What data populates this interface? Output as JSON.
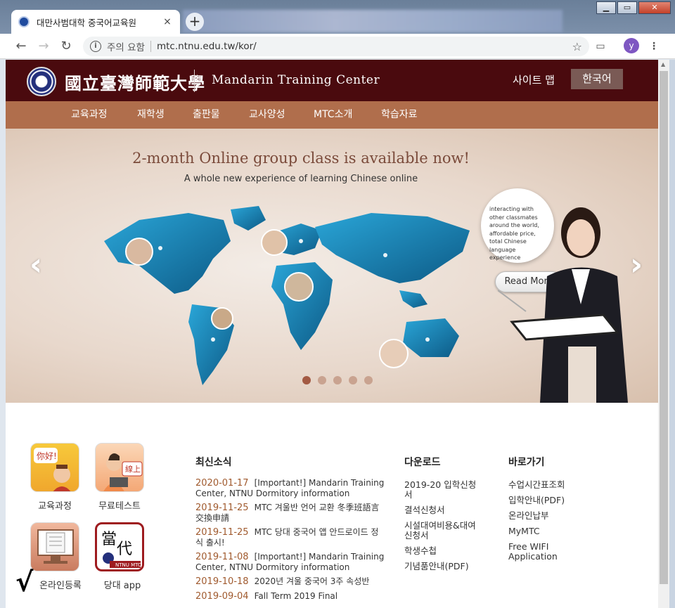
{
  "browser": {
    "tab_title": "대만사범대학 중국어교육원",
    "tab_close": "×",
    "new_tab": "+",
    "window_controls": {
      "minimize": "▁",
      "maximize": "▭",
      "close": "✕"
    },
    "security_label": "주의 요함",
    "url": "mtc.ntnu.edu.tw/kor/",
    "profile_initial": "y"
  },
  "site": {
    "logo_cn": "國立臺灣師範大學",
    "logo_en": "Mandarin Training Center",
    "sitemap": "사이트 맵",
    "language": "한국어",
    "nav": [
      "교육과정",
      "재학생",
      "출판물",
      "교사양성",
      "MTC소개",
      "학습자료"
    ]
  },
  "banner": {
    "title": "2-month Online group class is available now!",
    "subtitle": "A whole new experience of learning Chinese online",
    "bubble_text": "interacting with other classmates around the world, affordable price, total Chinese language experience",
    "read_more": "Read More",
    "slide_count": 5,
    "active_slide": 1
  },
  "apps": [
    {
      "label": "교육과정",
      "icon": "hello-character-icon"
    },
    {
      "label": "무료테스트",
      "icon": "online-test-icon"
    },
    {
      "label": "온라인등록",
      "icon": "computer-document-icon"
    },
    {
      "label": "당대 app",
      "icon": "dangdai-app-icon"
    }
  ],
  "news": {
    "title": "최신소식",
    "items": [
      {
        "date": "2020-01-17",
        "text": "[Important!] Mandarin Training Center, NTNU Dormitory information"
      },
      {
        "date": "2019-11-25",
        "text": "MTC 겨울반 언어 교환 冬季班語言交換申請"
      },
      {
        "date": "2019-11-25",
        "text": "MTC 당대 중국어 앱 안드로이드 정식 출시!"
      },
      {
        "date": "2019-11-08",
        "text": "[Important!] Mandarin Training Center, NTNU Dormitory information"
      },
      {
        "date": "2019-10-18",
        "text": "2020년 겨울 중국어 3주 속성반"
      },
      {
        "date": "2019-09-04",
        "text": "Fall Term 2019 Final"
      }
    ]
  },
  "downloads": {
    "title": "다운로드",
    "items": [
      "2019-20 입학신청서",
      "결석신청서",
      "시설대여비용&대여신청서",
      "학생수첩",
      "기념품안내(PDF)"
    ]
  },
  "shortcuts": {
    "title": "바로가기",
    "items": [
      "수업시간표조회",
      "입학안내(PDF)",
      "온라인납부",
      "MyMTC",
      "Free WIFI Application"
    ]
  },
  "colors": {
    "header": "#4a0a0e",
    "nav": "#b06e4c",
    "date": "#a05a2e"
  }
}
